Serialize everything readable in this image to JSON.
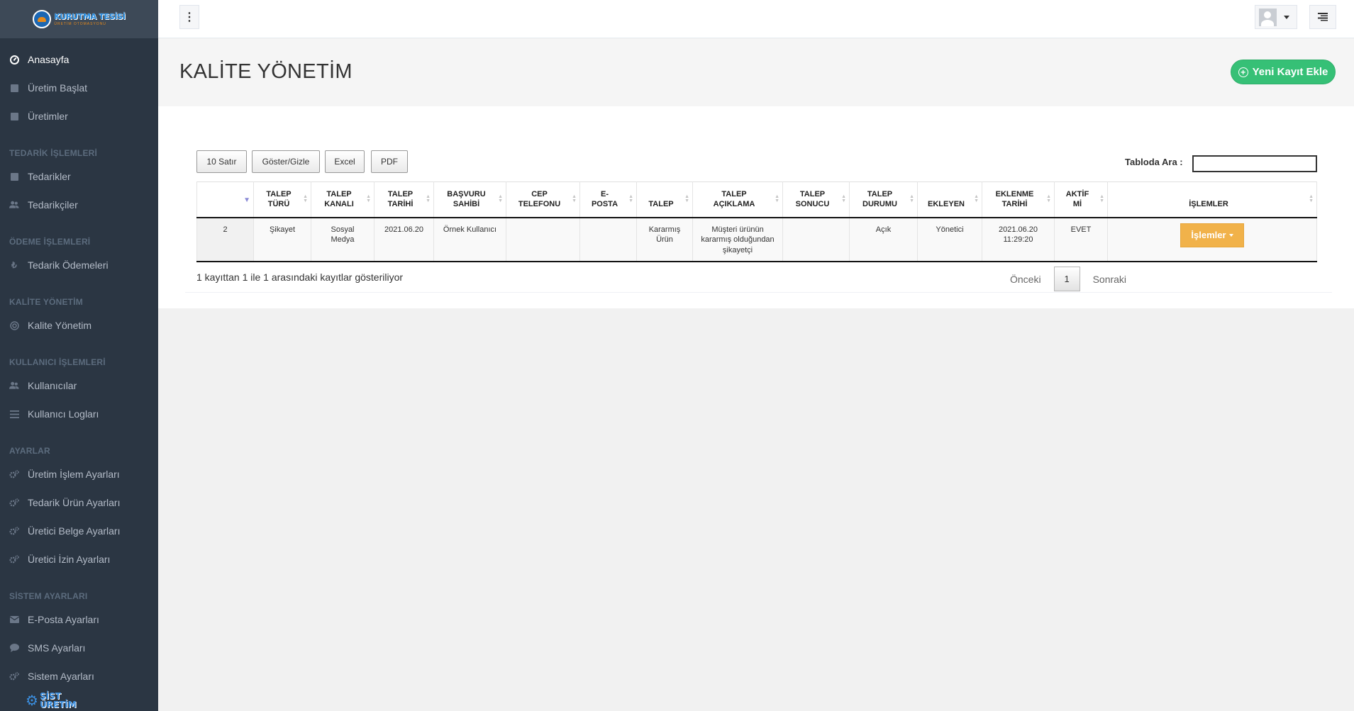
{
  "sidebar": {
    "logo": {
      "line1": "KURUTMA TESİSİ",
      "line2": "ÜRETİM OTOMASYONU"
    },
    "items": [
      {
        "type": "item",
        "label": "Anasayfa",
        "icon": "dashboard-icon",
        "active": true
      },
      {
        "type": "item",
        "label": "Üretim Başlat",
        "icon": "square-icon"
      },
      {
        "type": "item",
        "label": "Üretimler",
        "icon": "square-icon"
      },
      {
        "type": "section",
        "label": "TEDARİK İŞLEMLERİ"
      },
      {
        "type": "item",
        "label": "Tedarikler",
        "icon": "square-icon"
      },
      {
        "type": "item",
        "label": "Tedarikçiler",
        "icon": "users-icon"
      },
      {
        "type": "section",
        "label": "ÖDEME İŞLEMLERİ"
      },
      {
        "type": "item",
        "label": "Tedarik Ödemeleri",
        "icon": "lira-icon"
      },
      {
        "type": "section",
        "label": "KALİTE YÖNETİM"
      },
      {
        "type": "item",
        "label": "Kalite Yönetim",
        "icon": "support-icon"
      },
      {
        "type": "section",
        "label": "KULLANICI İŞLEMLERİ"
      },
      {
        "type": "item",
        "label": "Kullanıcılar",
        "icon": "users-icon"
      },
      {
        "type": "item",
        "label": "Kullanıcı Logları",
        "icon": "list-icon"
      },
      {
        "type": "section",
        "label": "AYARLAR"
      },
      {
        "type": "item",
        "label": "Üretim İşlem Ayarları",
        "icon": "cogs-icon"
      },
      {
        "type": "item",
        "label": "Tedarik Ürün Ayarları",
        "icon": "cogs-icon"
      },
      {
        "type": "item",
        "label": "Üretici Belge Ayarları",
        "icon": "cogs-icon"
      },
      {
        "type": "item",
        "label": "Üretici İzin Ayarları",
        "icon": "cogs-icon"
      },
      {
        "type": "section",
        "label": "SİSTEM AYARLARI"
      },
      {
        "type": "item",
        "label": "E-Posta Ayarları",
        "icon": "envelope-icon"
      },
      {
        "type": "item",
        "label": "SMS Ayarları",
        "icon": "comment-icon"
      },
      {
        "type": "item",
        "label": "Sistem Ayarları",
        "icon": "cogs-icon"
      }
    ],
    "bottom_logo": {
      "line1": "SİST",
      "line2": "ÜRETİM"
    }
  },
  "page": {
    "title": "KALİTE YÖNETİM",
    "new_button": "Yeni Kayıt Ekle"
  },
  "toolbar": {
    "rows_button": "10 Satır",
    "toggle_button": "Göster/Gizle",
    "excel_button": "Excel",
    "pdf_button": "PDF",
    "search_label": "Tabloda Ara :",
    "search_value": ""
  },
  "table": {
    "columns": [
      {
        "label": "",
        "sort": "desc"
      },
      {
        "label": "TALEP\nTÜRÜ"
      },
      {
        "label": "TALEP\nKANALI"
      },
      {
        "label": "TALEP\nTARİHİ"
      },
      {
        "label": "BAŞVURU\nSAHİBİ"
      },
      {
        "label": "CEP\nTELEFONU"
      },
      {
        "label": "E-\nPOSTA"
      },
      {
        "label": "TALEP"
      },
      {
        "label": "TALEP\nAÇIKLAMA"
      },
      {
        "label": "TALEP\nSONUCU"
      },
      {
        "label": "TALEP\nDURUMU"
      },
      {
        "label": "EKLEYEN"
      },
      {
        "label": "EKLENME\nTARİHİ"
      },
      {
        "label": "AKTİF\nMİ"
      },
      {
        "label": "İŞLEMLER"
      }
    ],
    "rows": [
      {
        "cells": [
          "2",
          "Şikayet",
          "Sosyal\nMedya",
          "2021.06.20",
          "Örnek Kullanıcı",
          "",
          "",
          "Kararmış\nÜrün",
          "Müşteri ürünün\nkararmış olduğundan\nşikayetçi",
          "",
          "Açık",
          "Yönetici",
          "2021.06.20\n11:29:20",
          "EVET"
        ],
        "action_label": "İşlemler"
      }
    ]
  },
  "footer": {
    "info": "1 kayıttan 1 ile 1 arasındaki kayıtlar gösteriliyor",
    "prev": "Önceki",
    "current_page": "1",
    "next": "Sonraki"
  }
}
